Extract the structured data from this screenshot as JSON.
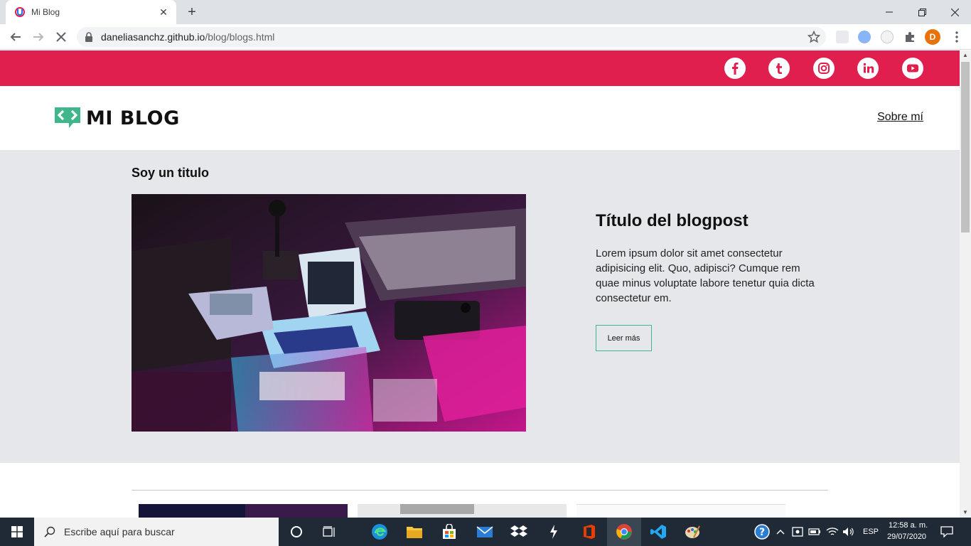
{
  "browser": {
    "tab_title": "Mi Blog",
    "new_tab": "+",
    "url_host": "daneliasanchz.github.io",
    "url_path": "/blog/blogs.html",
    "profile_initial": "D"
  },
  "page": {
    "logo_text": "MI BLOG",
    "nav_link": "Sobre mí",
    "social": [
      "facebook-icon",
      "tumblr-icon",
      "instagram-icon",
      "linkedin-icon",
      "youtube-icon"
    ],
    "brand_color": "#e01f4e",
    "accent_color": "#3fb68b",
    "featured": {
      "section_title": "Soy un titulo",
      "post_title": "Título del blogpost",
      "post_text": "Lorem ipsum dolor sit amet consectetur adipisicing elit. Quo, adipisci? Cumque rem quae minus voluptate labore tenetur quia dicta consectetur em.",
      "read_more": "Leer más"
    }
  },
  "taskbar": {
    "search_placeholder": "Escribe aquí para buscar",
    "language": "ESP",
    "time": "12:58 a. m.",
    "date": "29/07/2020"
  }
}
